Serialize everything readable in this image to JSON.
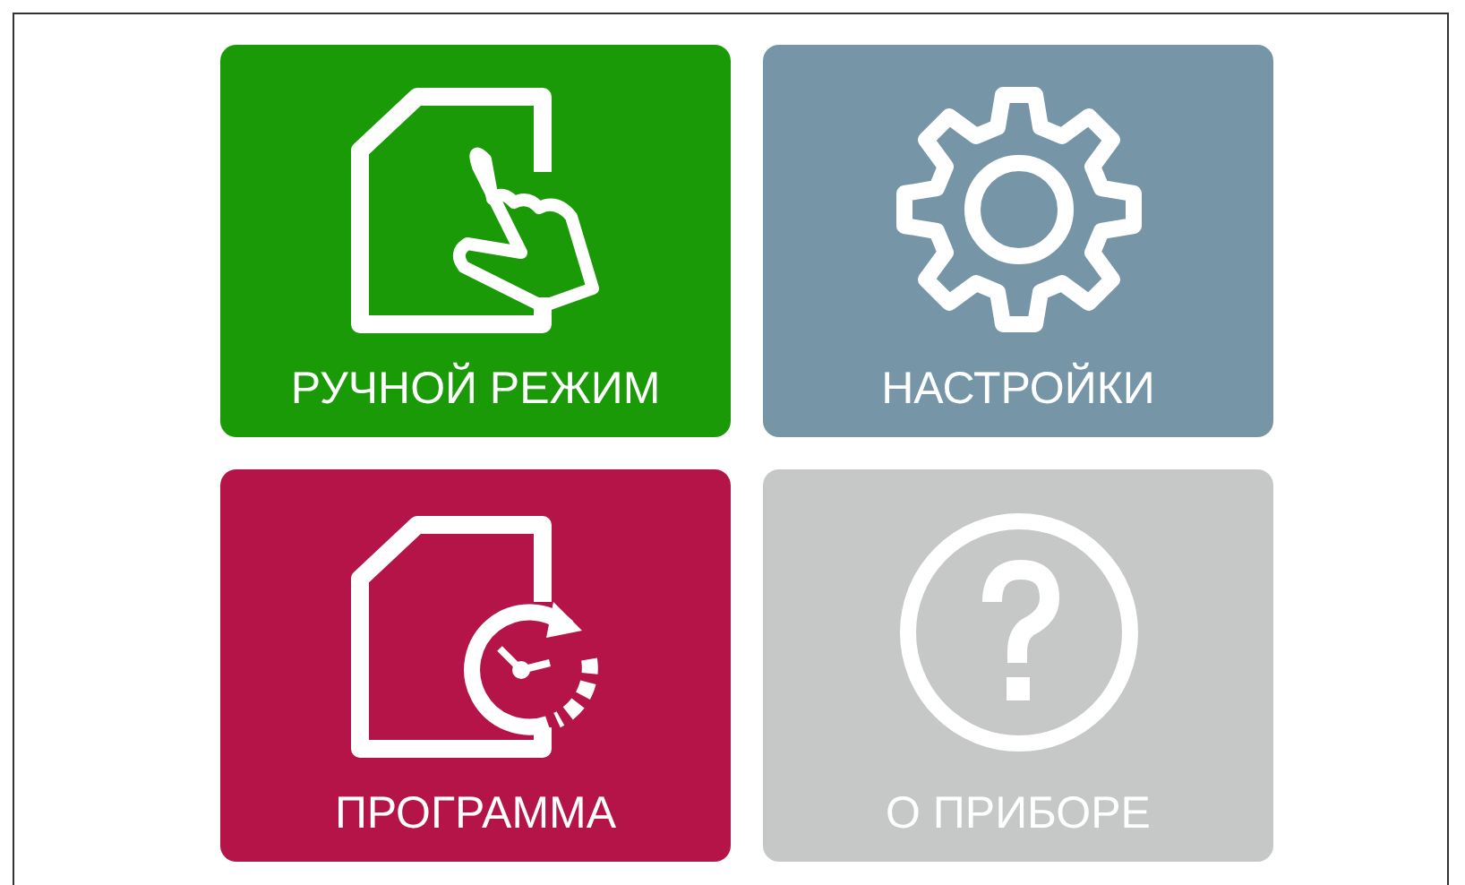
{
  "tiles": [
    {
      "label": "РУЧНОЙ РЕЖИМ",
      "kind": "manual",
      "color": "#199a06"
    },
    {
      "label": "НАСТРОЙКИ",
      "kind": "settings",
      "color": "#7696a8"
    },
    {
      "label": "ПРОГРАММА",
      "kind": "program",
      "color": "#b41447"
    },
    {
      "label": "О ПРИБОРЕ",
      "kind": "about",
      "color": "#c6c7c7"
    }
  ]
}
